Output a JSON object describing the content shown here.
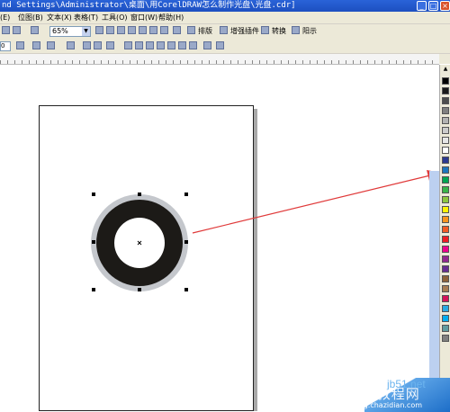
{
  "window": {
    "title": "nd Settings\\Administrator\\桌面\\用CorelDRAW怎么制作光盘\\光盘.cdr]",
    "minimize_glyph": "_",
    "maximize_glyph": "□",
    "close_glyph": "×"
  },
  "menu": [
    "(E)",
    "位图(B)",
    "文本(X)",
    "表格(T)",
    "工具(O)",
    "窗口(W)",
    "帮助(H)"
  ],
  "toolbar1": {
    "zoom": "65%",
    "labels": [
      "排版",
      "增强插件",
      "转换",
      "阳示"
    ]
  },
  "toolbar2": {
    "position_value": "0"
  },
  "palette": {
    "swatches": [
      "#000000",
      "#1a1a1a",
      "#4d4d4d",
      "#808080",
      "#b3b3b3",
      "#cccccc",
      "#e6e6e6",
      "#ffffff",
      "#2b3990",
      "#1c75bc",
      "#00a651",
      "#39b54a",
      "#8dc63f",
      "#fff200",
      "#f7941d",
      "#f15a24",
      "#ed1c24",
      "#ec008c",
      "#92278f",
      "#662d91",
      "#8c6239",
      "#a67c52",
      "#d4145a",
      "#29abe2",
      "#00aeef",
      "#5e9ca0",
      "#7f7f7f"
    ]
  },
  "watermark": {
    "site": "jb51.net",
    "cn_text": "查字典 教程网",
    "url_text": "jiaocheng.chazidian.com"
  },
  "colors": {
    "ring_outer": "#c4c7cc",
    "ring_inner": "#1c1a17",
    "arrow": "#e03a3a"
  }
}
